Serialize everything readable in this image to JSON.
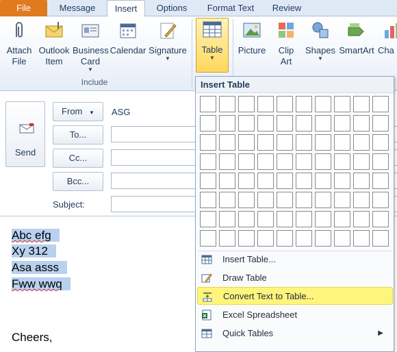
{
  "tabs": [
    {
      "label": "File"
    },
    {
      "label": "Message"
    },
    {
      "label": "Insert"
    },
    {
      "label": "Options"
    },
    {
      "label": "Format Text"
    },
    {
      "label": "Review"
    }
  ],
  "ribbon": {
    "attach_file": [
      "Attach",
      "File"
    ],
    "outlook_item": [
      "Outlook",
      "Item"
    ],
    "business_card": [
      "Business",
      "Card"
    ],
    "calendar": "Calendar",
    "signature": "Signature",
    "table": "Table",
    "picture": "Picture",
    "clip_art": [
      "Clip",
      "Art"
    ],
    "shapes": "Shapes",
    "smartart": "SmartArt",
    "chart": "Cha",
    "group_include": "Include"
  },
  "mail": {
    "send": "Send",
    "from_button": "From",
    "from_value": "ASG",
    "to_button": "To...",
    "cc_button": "Cc...",
    "bcc_button": "Bcc...",
    "subject_label": "Subject:"
  },
  "body": {
    "lines": [
      "Abc efg",
      "Xy 312",
      "Asa asss",
      "Fww wwq"
    ],
    "closing": "Cheers,"
  },
  "dropdown": {
    "title": "Insert Table",
    "grid": {
      "columns": 10,
      "rows": 8
    },
    "items": [
      {
        "label": "Insert Table...",
        "icon": "insert-table-icon"
      },
      {
        "label": "Draw Table",
        "icon": "draw-table-icon"
      },
      {
        "label": "Convert Text to Table...",
        "icon": "convert-text-to-table-icon",
        "highlighted": true
      },
      {
        "label": "Excel Spreadsheet",
        "icon": "excel-spreadsheet-icon"
      },
      {
        "label": "Quick Tables",
        "icon": "quick-tables-icon",
        "submenu": true
      }
    ]
  },
  "colors": {
    "file_tab": "#e07a1f",
    "highlight": "#fff57d",
    "selection": "#b8d1ef",
    "spellcheck": "#d03030"
  }
}
